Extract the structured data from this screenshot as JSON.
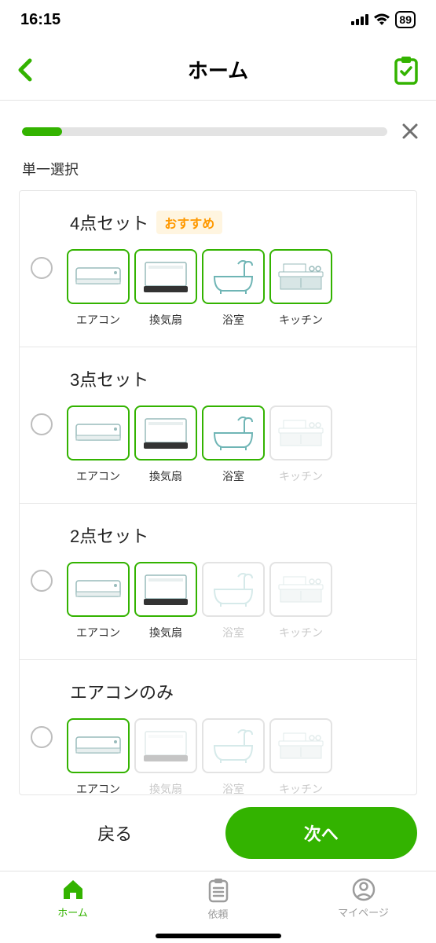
{
  "status": {
    "time": "16:15",
    "battery": "89"
  },
  "header": {
    "title": "ホーム"
  },
  "progress": {
    "percent": 11
  },
  "section_label": "単一選択",
  "badge_label": "おすすめ",
  "options": [
    {
      "title": "4点セット",
      "recommended": true,
      "items": [
        {
          "label": "エアコン",
          "icon": "aircon",
          "active": true
        },
        {
          "label": "換気扇",
          "icon": "fan",
          "active": true
        },
        {
          "label": "浴室",
          "icon": "bath",
          "active": true
        },
        {
          "label": "キッチン",
          "icon": "kitchen",
          "active": true
        }
      ]
    },
    {
      "title": "3点セット",
      "recommended": false,
      "items": [
        {
          "label": "エアコン",
          "icon": "aircon",
          "active": true
        },
        {
          "label": "換気扇",
          "icon": "fan",
          "active": true
        },
        {
          "label": "浴室",
          "icon": "bath",
          "active": true
        },
        {
          "label": "キッチン",
          "icon": "kitchen",
          "active": false
        }
      ]
    },
    {
      "title": "2点セット",
      "recommended": false,
      "items": [
        {
          "label": "エアコン",
          "icon": "aircon",
          "active": true
        },
        {
          "label": "換気扇",
          "icon": "fan",
          "active": true
        },
        {
          "label": "浴室",
          "icon": "bath",
          "active": false
        },
        {
          "label": "キッチン",
          "icon": "kitchen",
          "active": false
        }
      ]
    },
    {
      "title": "エアコンのみ",
      "recommended": false,
      "items": [
        {
          "label": "エアコン",
          "icon": "aircon",
          "active": true
        },
        {
          "label": "換気扇",
          "icon": "fan",
          "active": false
        },
        {
          "label": "浴室",
          "icon": "bath",
          "active": false
        },
        {
          "label": "キッチン",
          "icon": "kitchen",
          "active": false
        }
      ]
    }
  ],
  "footer": {
    "back": "戻る",
    "next": "次へ"
  },
  "tabs": {
    "home": "ホーム",
    "request": "依頼",
    "mypage": "マイページ"
  }
}
